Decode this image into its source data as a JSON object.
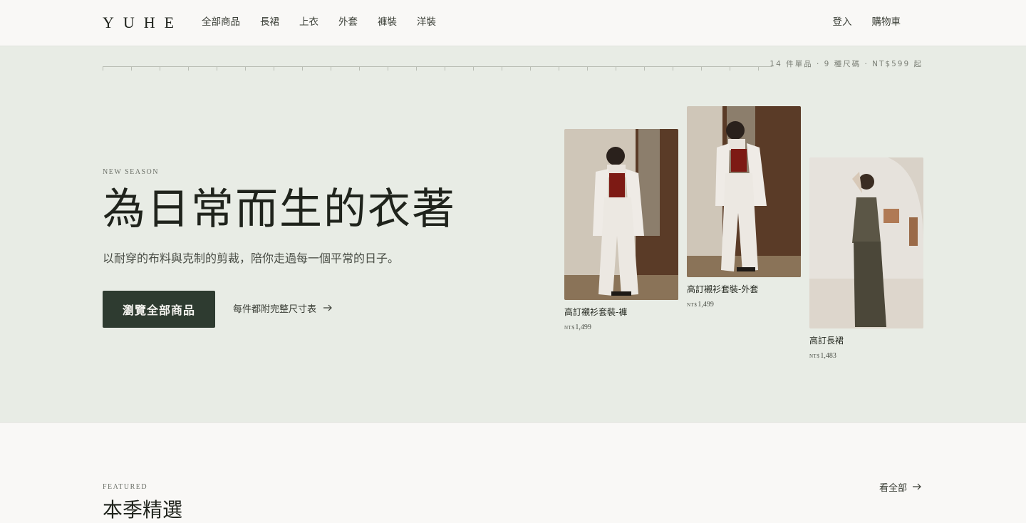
{
  "header": {
    "logo": "YUHE",
    "nav": [
      "全部商品",
      "長裙",
      "上衣",
      "外套",
      "褲裝",
      "洋裝"
    ],
    "login": "登入",
    "cart": "購物車"
  },
  "hero": {
    "stats": "14 件單品 · 9 種尺碼 · NT$599 起",
    "eyebrow": "NEW SEASON",
    "headline": "為日常而生的衣著",
    "subline": "以耐穿的布料與克制的剪裁，陪你走過每一個平常的日子。",
    "cta": "瀏覽全部商品",
    "size_link": "每件都附完整尺寸表",
    "size_link_icon": "arrow-right-icon"
  },
  "products": [
    {
      "name": "高訂襯衫套裝-褲",
      "currency": "NT$",
      "price": "1,499",
      "image": "model in white shirt set with red top"
    },
    {
      "name": "高訂襯衫套裝-外套",
      "currency": "NT$",
      "price": "1,499",
      "image": "model in white jacket set with red top"
    },
    {
      "name": "高訂長裙",
      "currency": "NT$",
      "price": "1,483",
      "image": "model in olive satin slip dress"
    }
  ],
  "featured": {
    "eyebrow": "FEATURED",
    "title": "本季精選",
    "view_all": "看全部",
    "view_all_icon": "arrow-right-icon"
  },
  "colors": {
    "page_bg": "#f9f8f6",
    "hero_bg": "#e8ece5",
    "cta_bg": "#2e3b30",
    "text": "#23271f"
  }
}
